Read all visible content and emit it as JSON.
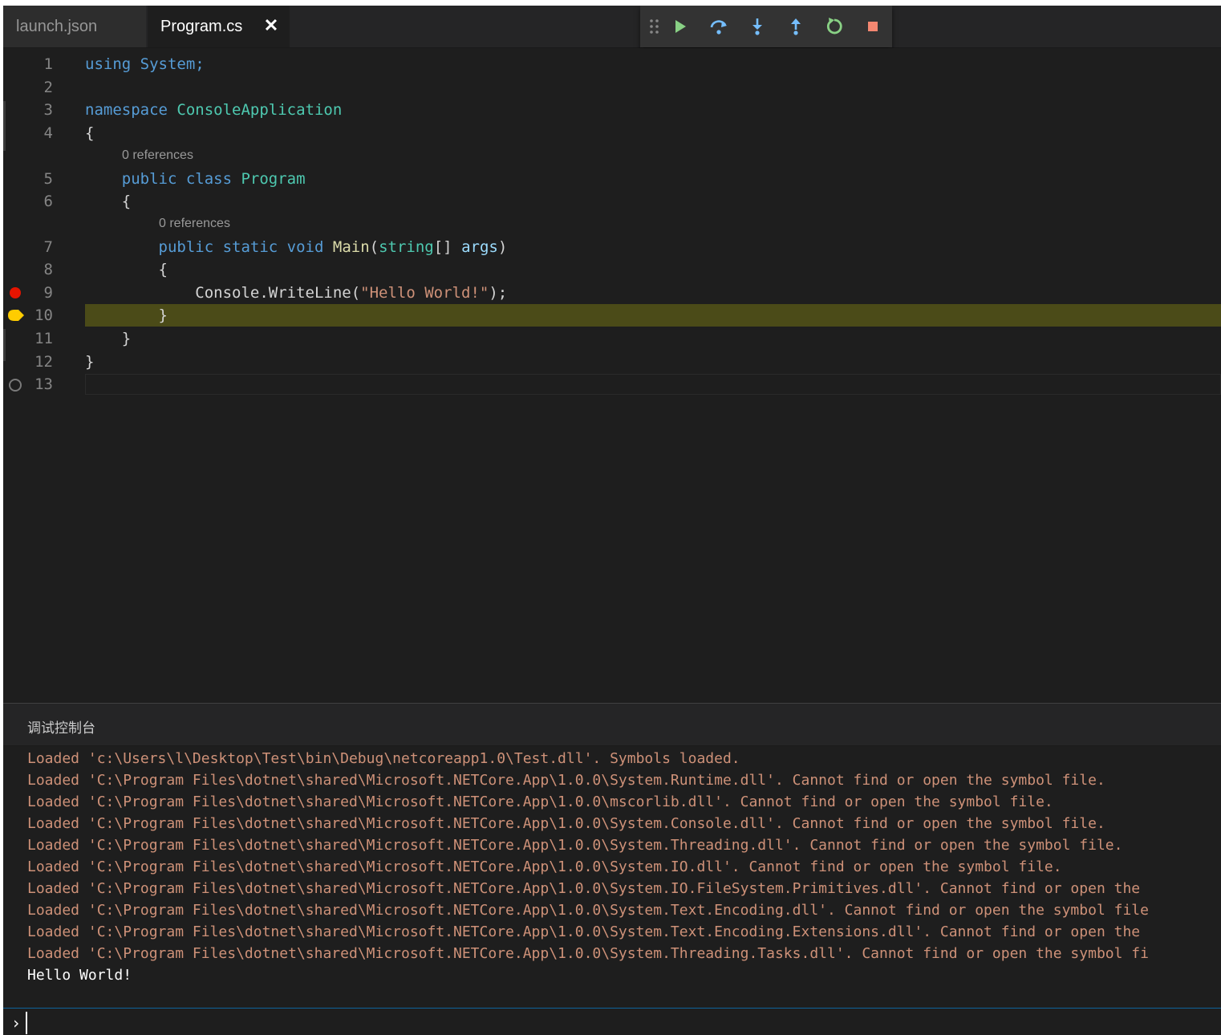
{
  "tabs": [
    {
      "label": "launch.json",
      "active": false
    },
    {
      "label": "Program.cs",
      "active": true,
      "close_glyph": "✕"
    }
  ],
  "debug_toolbar": {
    "items": [
      "drag-handle-icon",
      "continue-icon",
      "step-over-icon",
      "step-into-icon",
      "step-out-icon",
      "restart-icon",
      "stop-icon"
    ]
  },
  "editor": {
    "lines": [
      {
        "n": "1",
        "tokens": [
          [
            "kw",
            "using"
          ],
          [
            "",
            ""
          ],
          [
            "kw",
            " System;"
          ]
        ]
      },
      {
        "n": "2",
        "tokens": []
      },
      {
        "n": "3",
        "tokens": [
          [
            "kw",
            "namespace"
          ],
          [
            "ty",
            " ConsoleApplication"
          ]
        ]
      },
      {
        "n": "4",
        "tokens": [
          [
            "",
            "{"
          ]
        ]
      },
      {
        "n": "5",
        "tokens": [
          [
            "",
            "    "
          ],
          [
            "kw",
            "public"
          ],
          [
            "kw",
            " class"
          ],
          [
            "ty",
            " Program"
          ]
        ]
      },
      {
        "n": "6",
        "tokens": [
          [
            "",
            "    {"
          ]
        ]
      },
      {
        "n": "7",
        "tokens": [
          [
            "",
            "        "
          ],
          [
            "kw",
            "public"
          ],
          [
            "kw",
            " static"
          ],
          [
            "kw",
            " void"
          ],
          [
            "fn",
            " Main"
          ],
          [
            "",
            "("
          ],
          [
            "ty",
            "string"
          ],
          [
            "",
            "[] "
          ],
          [
            "pa",
            "args"
          ],
          [
            "",
            ")"
          ]
        ]
      },
      {
        "n": "8",
        "tokens": [
          [
            "",
            "        {"
          ]
        ]
      },
      {
        "n": "9",
        "tokens": [
          [
            "",
            "            Console.WriteLine("
          ],
          [
            "st",
            "\"Hello World!\""
          ],
          [
            "",
            ");"
          ]
        ]
      },
      {
        "n": "10",
        "tokens": [
          [
            "",
            "        }"
          ]
        ]
      },
      {
        "n": "11",
        "tokens": [
          [
            "",
            "    }"
          ]
        ]
      },
      {
        "n": "12",
        "tokens": [
          [
            "",
            "}"
          ]
        ]
      },
      {
        "n": "13",
        "tokens": []
      }
    ],
    "codelens": [
      "0 references",
      "0 references"
    ]
  },
  "panel": {
    "title": "调试控制台",
    "console_lines": [
      "Loaded 'c:\\Users\\l\\Desktop\\Test\\bin\\Debug\\netcoreapp1.0\\Test.dll'. Symbols loaded.",
      "Loaded 'C:\\Program Files\\dotnet\\shared\\Microsoft.NETCore.App\\1.0.0\\System.Runtime.dll'. Cannot find or open the symbol file.",
      "Loaded 'C:\\Program Files\\dotnet\\shared\\Microsoft.NETCore.App\\1.0.0\\mscorlib.dll'. Cannot find or open the symbol file.",
      "Loaded 'C:\\Program Files\\dotnet\\shared\\Microsoft.NETCore.App\\1.0.0\\System.Console.dll'. Cannot find or open the symbol file.",
      "Loaded 'C:\\Program Files\\dotnet\\shared\\Microsoft.NETCore.App\\1.0.0\\System.Threading.dll'. Cannot find or open the symbol file.",
      "Loaded 'C:\\Program Files\\dotnet\\shared\\Microsoft.NETCore.App\\1.0.0\\System.IO.dll'. Cannot find or open the symbol file.",
      "Loaded 'C:\\Program Files\\dotnet\\shared\\Microsoft.NETCore.App\\1.0.0\\System.IO.FileSystem.Primitives.dll'. Cannot find or open the",
      "Loaded 'C:\\Program Files\\dotnet\\shared\\Microsoft.NETCore.App\\1.0.0\\System.Text.Encoding.dll'. Cannot find or open the symbol file",
      "Loaded 'C:\\Program Files\\dotnet\\shared\\Microsoft.NETCore.App\\1.0.0\\System.Text.Encoding.Extensions.dll'. Cannot find or open the",
      "Loaded 'C:\\Program Files\\dotnet\\shared\\Microsoft.NETCore.App\\1.0.0\\System.Threading.Tasks.dll'. Cannot find or open the symbol fi"
    ],
    "program_output": "Hello World!",
    "repl_prompt": "›"
  },
  "colors": {
    "breakpoint": "#e51400",
    "current_line": "#4b4b18",
    "debug_arrow": "#ffcc00",
    "continue": "#89d185",
    "step": "#75beff",
    "stop": "#f48771"
  }
}
